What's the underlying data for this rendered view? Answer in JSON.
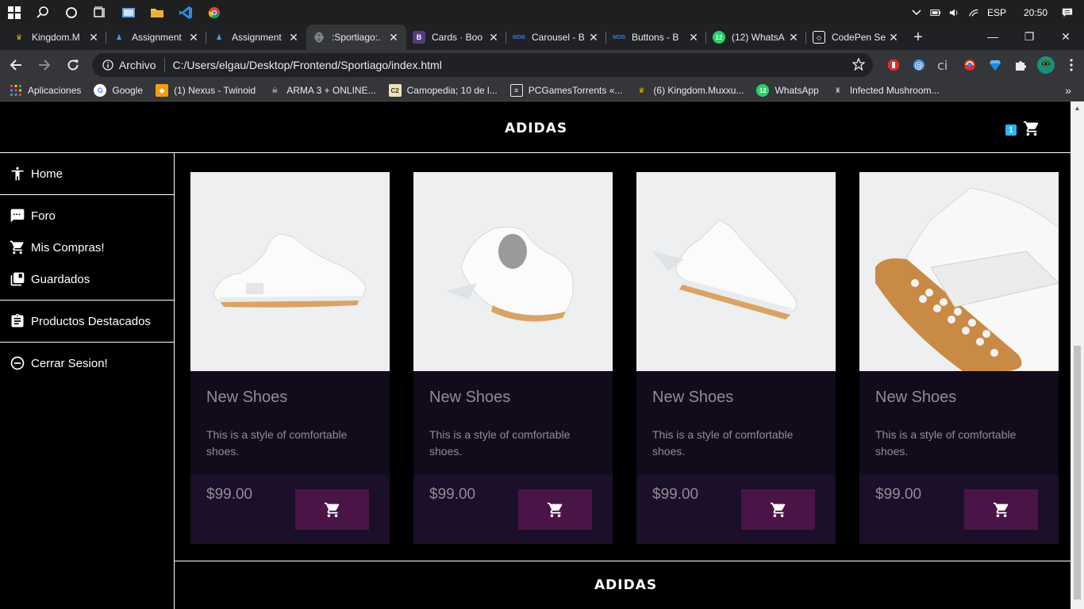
{
  "taskbar": {
    "language": "ESP",
    "time": "20:50",
    "icons": [
      "windows-start-icon",
      "search-icon",
      "cortana-icon",
      "task-view-icon",
      "photos-icon",
      "file-explorer-icon",
      "vscode-icon",
      "chrome-icon"
    ]
  },
  "tabs": [
    {
      "title": "Kingdom.M",
      "favicon": "crown-icon",
      "active": false
    },
    {
      "title": "Assignment",
      "favicon": "person-icon",
      "active": false
    },
    {
      "title": "Assignment",
      "favicon": "person-icon",
      "active": false
    },
    {
      "title": ":Sportiago:.",
      "favicon": "globe-icon",
      "active": true
    },
    {
      "title": "Cards · Boo",
      "favicon": "bootstrap-icon",
      "active": false
    },
    {
      "title": "Carousel - B",
      "favicon": "mdb-icon",
      "active": false
    },
    {
      "title": "Buttons - B",
      "favicon": "mdb-icon",
      "active": false
    },
    {
      "title": "(12) WhatsA",
      "favicon": "whatsapp-icon",
      "active": false
    },
    {
      "title": "CodePen Se",
      "favicon": "codepen-icon",
      "active": false
    }
  ],
  "omnibox": {
    "label": "Archivo",
    "url": "C:/Users/elgau/Desktop/Frontend/Sportiago/index.html"
  },
  "bookmarks": [
    {
      "label": "Aplicaciones",
      "icon": "apps-grid-icon"
    },
    {
      "label": "Google",
      "icon": "google-icon"
    },
    {
      "label": "(1) Nexus - Twinoid",
      "icon": "nexus-icon"
    },
    {
      "label": "ARMA 3 + ONLINE...",
      "icon": "skull-icon"
    },
    {
      "label": "Camopedia; 10 de l...",
      "icon": "c2-icon"
    },
    {
      "label": "PCGamesTorrents «...",
      "icon": "document-icon"
    },
    {
      "label": "(6) Kingdom.Muxxu...",
      "icon": "crown-icon"
    },
    {
      "label": "WhatsApp",
      "icon": "whatsapp-icon"
    },
    {
      "label": "Infected Mushroom...",
      "icon": "mushroom-icon"
    }
  ],
  "site": {
    "brand": "ADIDAS",
    "cart_count": "1",
    "footer_brand": "ADIDAS"
  },
  "sidebar": {
    "groups": [
      [
        {
          "label": "Home",
          "icon": "accessibility-icon"
        }
      ],
      [
        {
          "label": "Foro",
          "icon": "chat-icon"
        },
        {
          "label": "Mis Compras!",
          "icon": "cart-icon"
        },
        {
          "label": "Guardados",
          "icon": "library-icon"
        }
      ],
      [
        {
          "label": "Productos Destacados",
          "icon": "assignment-icon"
        }
      ],
      [
        {
          "label": "Cerrar Sesion!",
          "icon": "remove-circle-icon"
        }
      ]
    ]
  },
  "products": [
    {
      "title": "New Shoes",
      "text": "This is a style of comfortable shoes.",
      "price": "$99.00",
      "view": "side"
    },
    {
      "title": "New Shoes",
      "text": "This is a style of comfortable shoes.",
      "price": "$99.00",
      "view": "back"
    },
    {
      "title": "New Shoes",
      "text": "This is a style of comfortable shoes.",
      "price": "$99.00",
      "view": "angle"
    },
    {
      "title": "New Shoes",
      "text": "This is a style of comfortable shoes.",
      "price": "$99.00",
      "view": "sole"
    }
  ],
  "colors": {
    "accent_button": "#4a1447",
    "card_body": "#120b1c",
    "card_footer": "#1c0f2a",
    "badge": "#29b6f6"
  }
}
